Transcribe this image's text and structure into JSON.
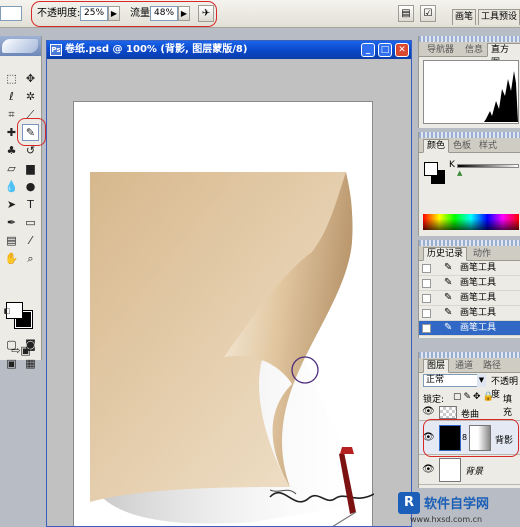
{
  "options_bar": {
    "opacity_label": "不透明度:",
    "opacity_value": "25%",
    "flow_label": "流量:",
    "flow_value": "48%",
    "right_tabs": [
      "画笔",
      "工具预设"
    ]
  },
  "document": {
    "title": "卷纸.psd @ 100% (背影, 图层蒙版/8)",
    "controls": {
      "minimize": "_",
      "maximize": "□",
      "close": "✕"
    }
  },
  "panels": {
    "navigator_tabs": [
      "导航器",
      "信息",
      "直方图"
    ],
    "color_tabs": [
      "颜色",
      "色板",
      "样式"
    ],
    "color_channel_label": "K",
    "history_tabs": [
      "历史记录",
      "动作"
    ],
    "history_items": [
      "画笔工具",
      "画笔工具",
      "画笔工具",
      "画笔工具",
      "画笔工具"
    ],
    "history_selected_index": 4,
    "layers_tabs": [
      "图层",
      "通道",
      "路径"
    ],
    "blend_mode": "正常",
    "opacity_label": "不透明度",
    "lock_label": "锁定:",
    "fill_label": "填充",
    "layers": [
      {
        "name": "卷曲"
      },
      {
        "name": "背影",
        "selected": true
      },
      {
        "name": "背景"
      }
    ]
  },
  "colors": {
    "highlight_ring": "#d62a2a",
    "titlebar": "#0a47c8",
    "paper": "#dcc3a0",
    "selection": "#3168c5"
  },
  "watermark": {
    "text": "软件自学网",
    "url": "www.hxsd.com.cn"
  }
}
